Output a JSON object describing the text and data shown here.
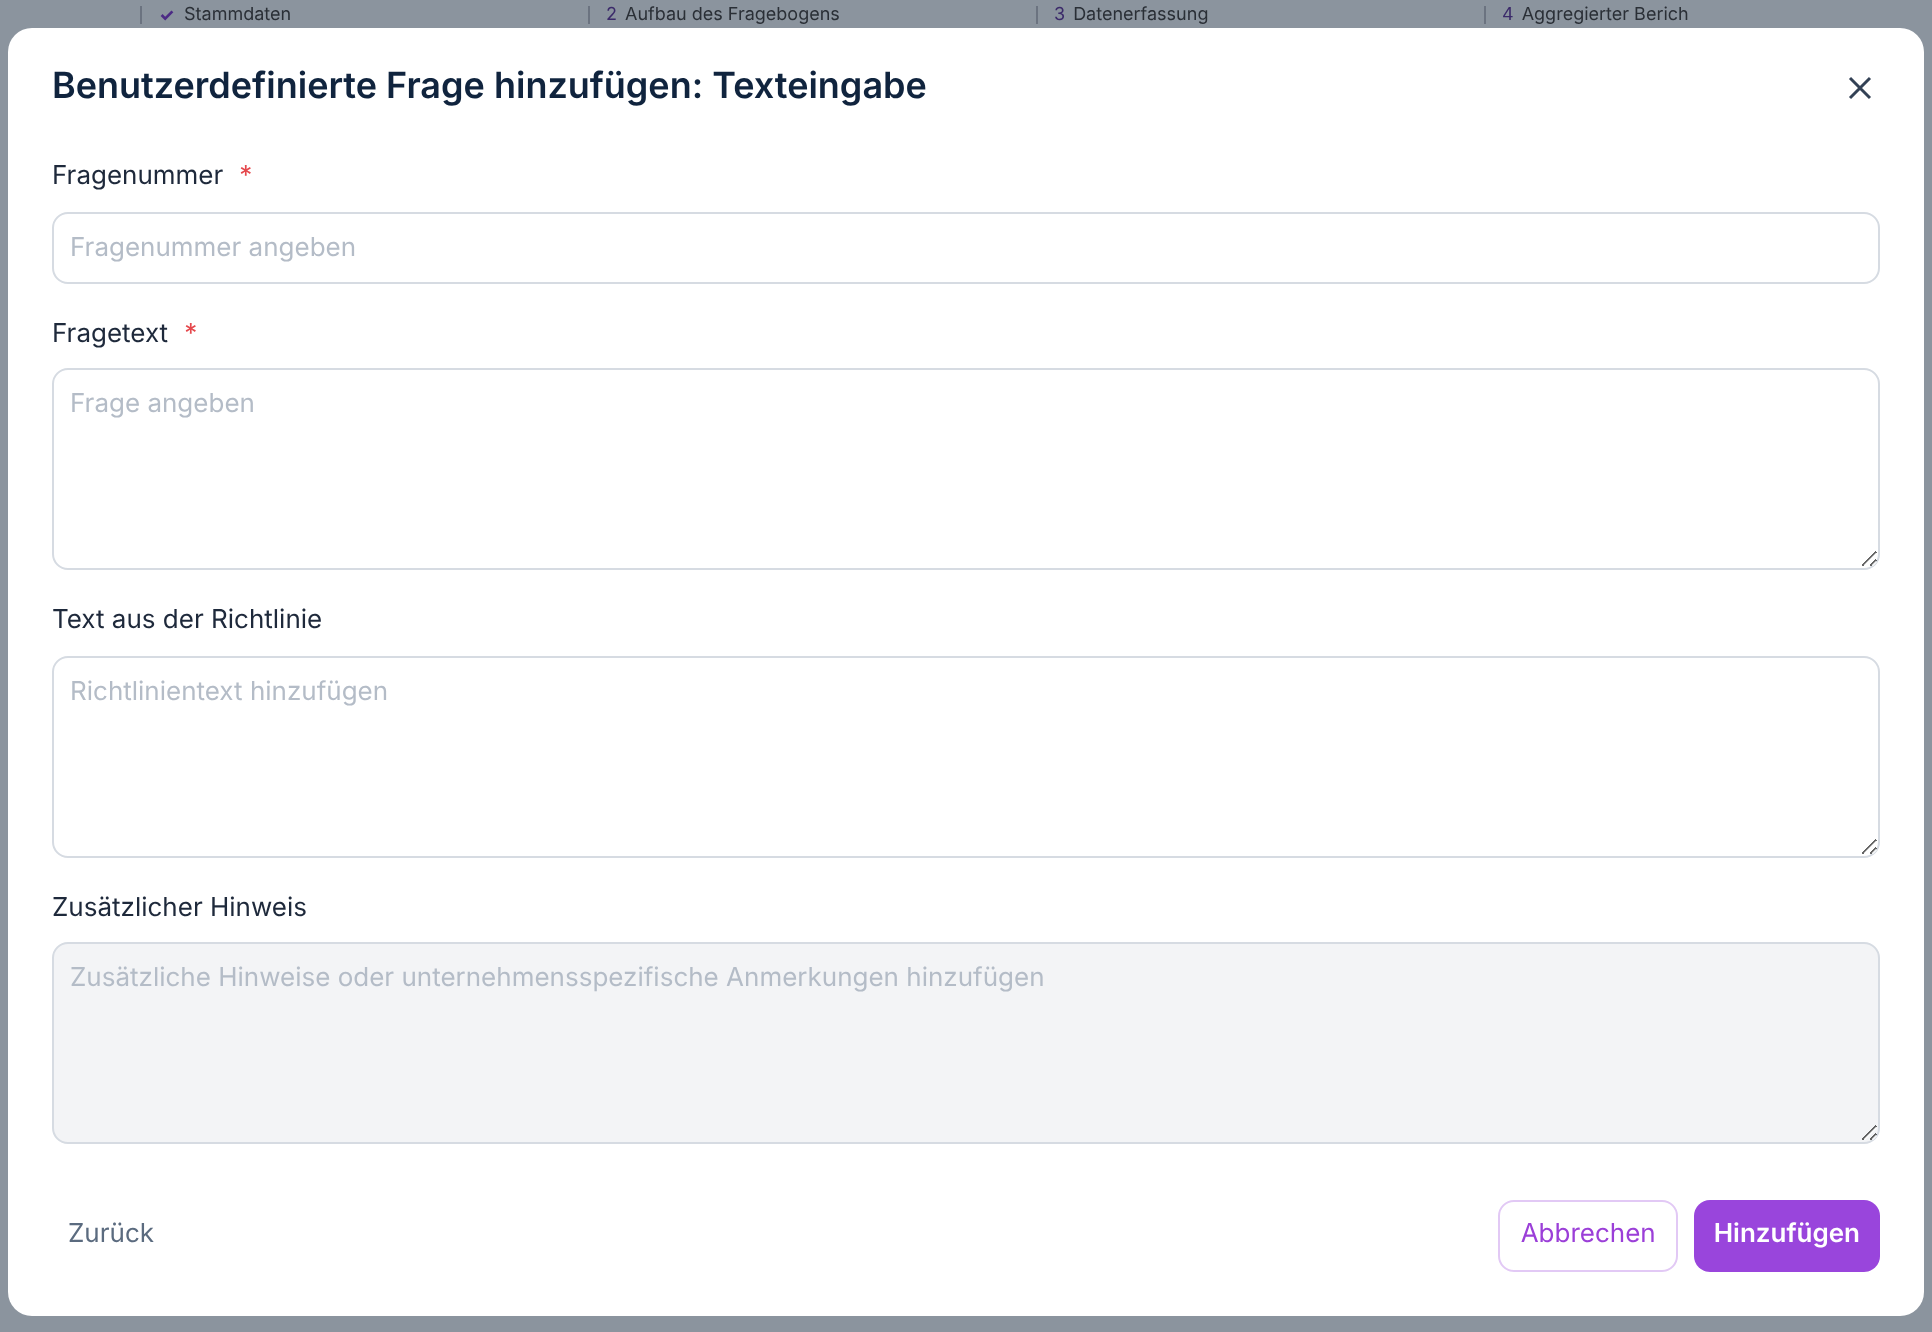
{
  "background_steps": [
    {
      "completed": true,
      "label": "Stammdaten"
    },
    {
      "number": "2",
      "completed": false,
      "label": "Aufbau des Fragebogens"
    },
    {
      "number": "3",
      "completed": false,
      "label": "Datenerfassung"
    },
    {
      "number": "4",
      "completed": false,
      "label": "Aggregierter Berich"
    }
  ],
  "dialog": {
    "title": "Benutzerdefinierte Frage hinzufügen: Texteingabe",
    "fields": [
      {
        "kind": "input",
        "label": "Fragenummer",
        "required": true,
        "placeholder": "Fragenummer angeben",
        "disabled": false
      },
      {
        "kind": "textarea",
        "label": "Fragetext",
        "required": true,
        "placeholder": "Frage angeben",
        "disabled": false
      },
      {
        "kind": "textarea",
        "label": "Text aus der Richtlinie",
        "required": false,
        "placeholder": "Richtlinientext hinzufügen",
        "disabled": false
      },
      {
        "kind": "textarea",
        "label": "Zusätzlicher Hinweis",
        "required": false,
        "placeholder": "Zusätzliche Hinweise oder unternehmensspezifische Anmerkungen hinzufügen",
        "disabled": true
      }
    ],
    "required_mark": "*",
    "back_button": "Zurück",
    "cancel_button": "Abbrechen",
    "submit_button": "Hinzufügen"
  }
}
